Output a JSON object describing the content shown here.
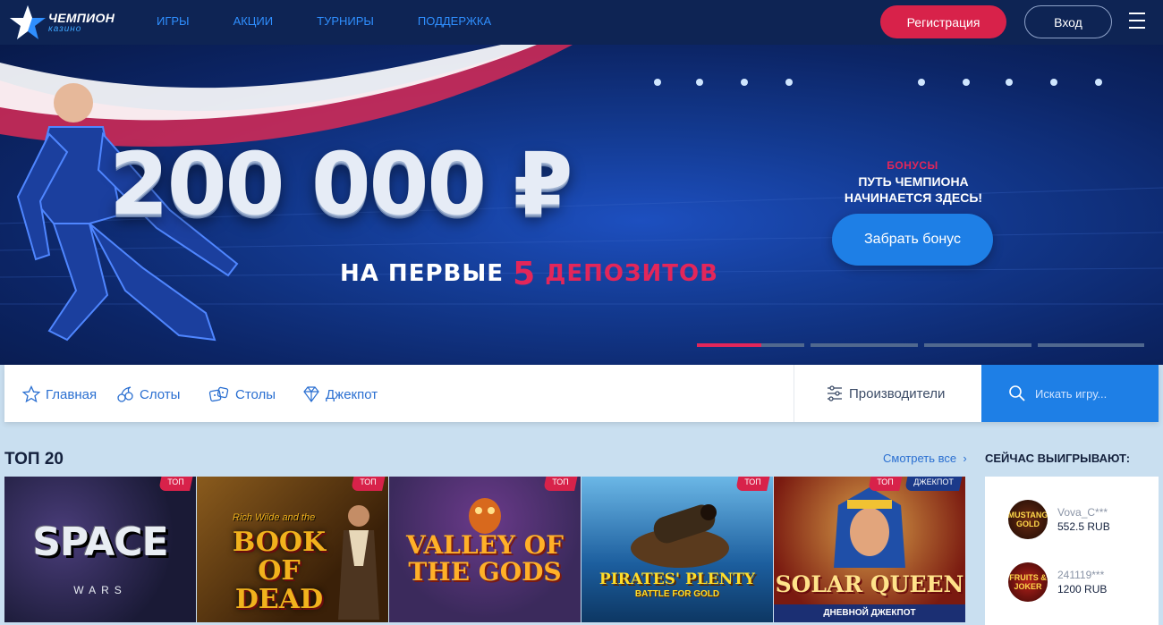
{
  "header": {
    "logo_title": "ЧЕМПИОН",
    "logo_sub": "казино",
    "nav": [
      "ИГРЫ",
      "АКЦИИ",
      "ТУРНИРЫ",
      "ПОДДЕРЖКА"
    ],
    "register_label": "Регистрация",
    "login_label": "Вход"
  },
  "banner": {
    "amount": "200 000 ₽",
    "deposits_pre": "НА ПЕРВЫЕ",
    "deposits_num": "5",
    "deposits_post": "ДЕПОЗИТОВ",
    "kicker": "БОНУСЫ",
    "title": "ПУТЬ ЧЕМПИОНА НАЧИНАЕТСЯ ЗДЕСЬ!",
    "cta": "Забрать бонус",
    "slides_total": 4,
    "active_slide": 1,
    "active_slide_progress": 0.6
  },
  "categories": {
    "items": [
      "Главная",
      "Слоты",
      "Столы",
      "Джекпот"
    ],
    "providers": "Производители",
    "search_placeholder": "Искать игру..."
  },
  "top": {
    "title": "ТОП 20",
    "see_all": "Смотреть все",
    "badge_top": "ТОП",
    "badge_jackpot": "ДЖЕКПОТ",
    "games": [
      {
        "title": "SPACE",
        "sub": "WARS"
      },
      {
        "title": "BOOK OF DEAD",
        "sub": "Rich Wilde and the"
      },
      {
        "title": "VALLEY OF THE GODS",
        "sub": ""
      },
      {
        "title": "PIRATES' PLENTY",
        "sub": "BATTLE FOR GOLD"
      },
      {
        "title": "SOLAR QUEEN",
        "sub": "ДНЕВНОЙ ДЖЕКПОТ"
      }
    ]
  },
  "winners": {
    "title": "СЕЙЧАС ВЫИГРЫВАЮТ:",
    "items": [
      {
        "name": "Vova_C***",
        "amount": "552.5 RUB",
        "game": "MUSTANG GOLD"
      },
      {
        "name": "241119***",
        "amount": "1200 RUB",
        "game": "FRUITS & JOKER"
      }
    ]
  },
  "colors": {
    "header_bg": "#0e2454",
    "nav_link": "#2f8fff",
    "accent_red": "#d8224a",
    "accent_blue": "#1e7fe6"
  }
}
